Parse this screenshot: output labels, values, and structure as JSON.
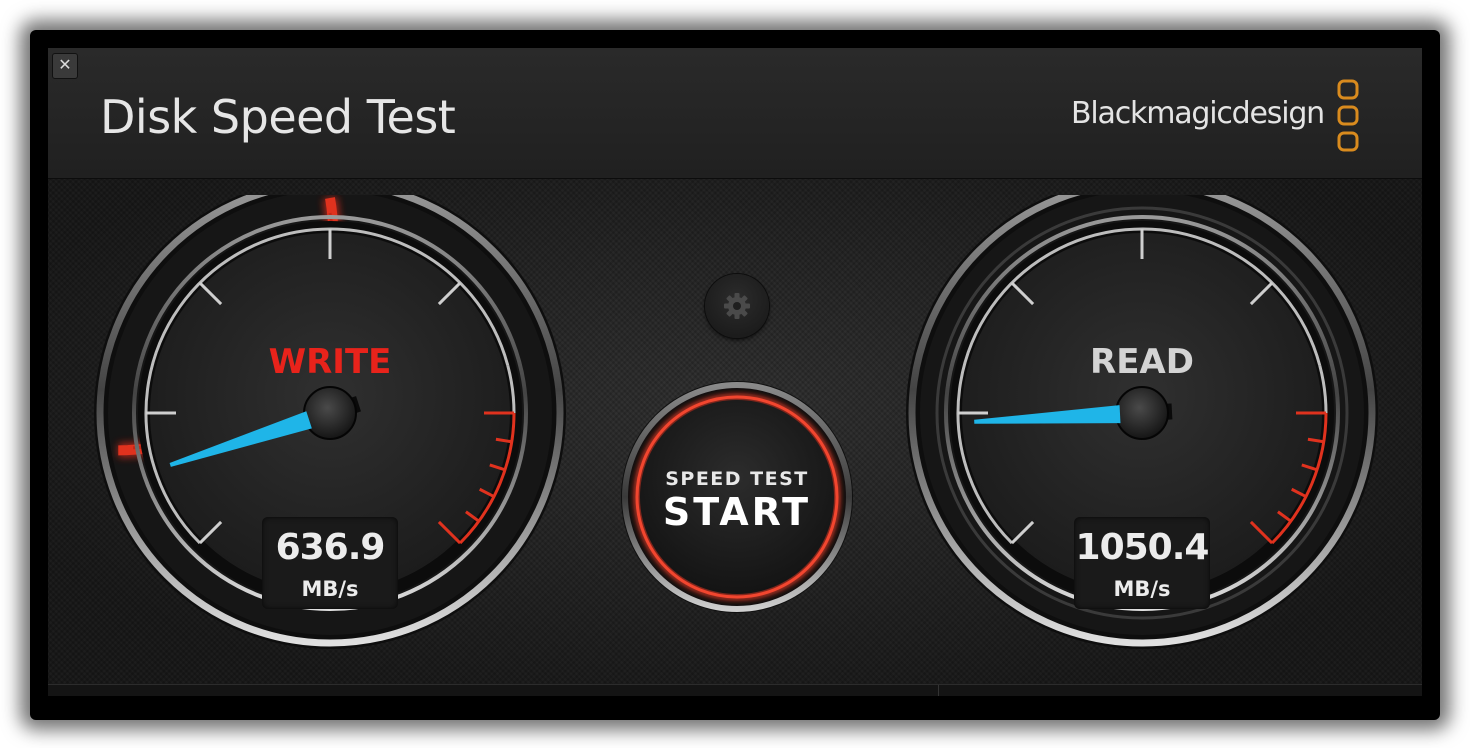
{
  "window": {
    "title": "Disk Speed Test",
    "close_label": "✕",
    "brand": "Blackmagicdesign"
  },
  "write_gauge": {
    "label": "WRITE",
    "value": "636.9",
    "unit": "MB/s",
    "label_color": "#e8231b",
    "active": true
  },
  "read_gauge": {
    "label": "READ",
    "value": "1050.4",
    "unit": "MB/s",
    "label_color": "#d4d4d4",
    "active": false
  },
  "start_button": {
    "line1": "SPEED TEST",
    "line2": "START"
  },
  "settings": {
    "icon": "gear-icon"
  },
  "colors": {
    "needle": "#1fb5e8",
    "accent_red": "#e0321e",
    "brand_orange": "#d98b1e"
  }
}
